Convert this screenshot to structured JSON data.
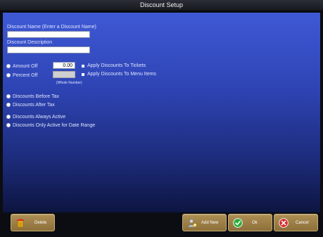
{
  "window": {
    "title": "Discount Setup"
  },
  "form": {
    "discount_name_label": "Discount Name  (Enter a Discount Name)",
    "discount_name_value": "",
    "discount_description_label": "Discount Description",
    "discount_description_value": "",
    "amount_off_label": "Amount Off",
    "amount_off_value": "0.00",
    "percent_off_label": "Percent Off",
    "percent_off_value": "",
    "whole_number_hint": "(Whole Number)",
    "apply_tickets_label": "Apply Discounts To Tickets",
    "apply_menu_items_label": "Apply Discounts To Menu Items",
    "before_tax_label": "Discounts Before Tax",
    "after_tax_label": "Discounts After Tax",
    "always_active_label": "Discounts Always Active",
    "date_range_label": "Discounts Only Active for Date Range"
  },
  "buttons": {
    "delete_label": "Delete",
    "add_new_label": "Add New",
    "ok_label": "Ok",
    "cancel_label": "Cancel"
  },
  "icons": {
    "delete": "trash-can-icon",
    "add_new": "add-person-icon",
    "ok": "green-check-icon",
    "cancel": "red-x-icon"
  },
  "colors": {
    "panel_top": "#3f59d6",
    "panel_bottom": "#0d1540",
    "button": "#9c7d45"
  }
}
